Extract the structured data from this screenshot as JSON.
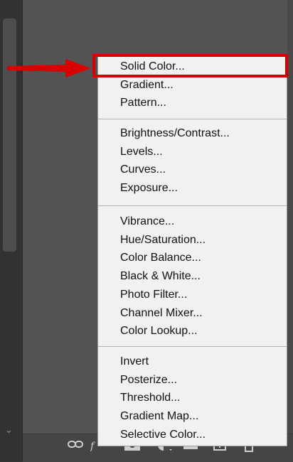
{
  "menu": {
    "groups": [
      [
        "Solid Color...",
        "Gradient...",
        "Pattern..."
      ],
      [
        "Brightness/Contrast...",
        "Levels...",
        "Curves...",
        "Exposure..."
      ],
      [
        "Vibrance...",
        "Hue/Saturation...",
        "Color Balance...",
        "Black & White...",
        "Photo Filter...",
        "Channel Mixer...",
        "Color Lookup..."
      ],
      [
        "Invert",
        "Posterize...",
        "Threshold...",
        "Gradient Map...",
        "Selective Color..."
      ]
    ]
  },
  "annotation": {
    "color": "#d90000",
    "target": "Solid Color..."
  },
  "bottom_bar_icons": [
    "link-icon",
    "fx-icon",
    "mask-icon",
    "adjustment-layer-icon",
    "group-folder-icon",
    "new-layer-icon",
    "trash-icon"
  ],
  "left_panel_icons": [
    "chevron-down-icon"
  ]
}
